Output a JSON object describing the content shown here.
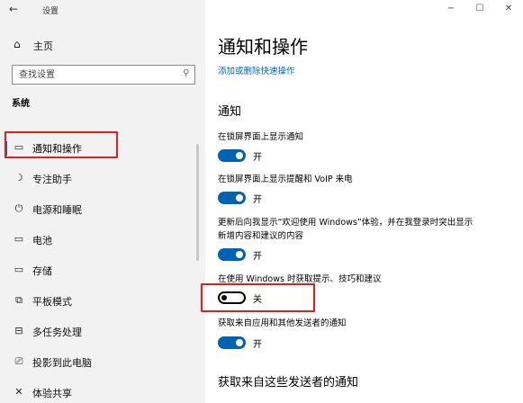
{
  "window": {
    "title": "设置",
    "back_glyph": "←",
    "controls": {
      "minimize": "−",
      "maximize": "☐",
      "close": "✕"
    }
  },
  "sidebar": {
    "home": {
      "label": "主页",
      "icon": "home-icon",
      "glyph": "⌂"
    },
    "search": {
      "placeholder": "查找设置",
      "icon": "search-icon",
      "glyph": "⚲"
    },
    "section": "系统",
    "sound": {
      "label": "声音",
      "icon": "speaker-icon",
      "glyph": "ᑁ))"
    },
    "items": [
      {
        "label": "通知和操作",
        "icon": "notification-icon",
        "glyph": "▭",
        "selected": true
      },
      {
        "label": "专注助手",
        "icon": "moon-icon",
        "glyph": "☽",
        "selected": false
      },
      {
        "label": "电源和睡眠",
        "icon": "power-icon",
        "glyph": "⏻",
        "selected": false
      },
      {
        "label": "电池",
        "icon": "battery-icon",
        "glyph": "▭",
        "selected": false
      },
      {
        "label": "存储",
        "icon": "storage-icon",
        "glyph": "▭",
        "selected": false
      },
      {
        "label": "平板模式",
        "icon": "tablet-mode-icon",
        "glyph": "⧉",
        "selected": false
      },
      {
        "label": "多任务处理",
        "icon": "multitasking-icon",
        "glyph": "⊟",
        "selected": false
      },
      {
        "label": "投影到此电脑",
        "icon": "projecting-icon",
        "glyph": "⎚",
        "selected": false
      },
      {
        "label": "体验共享",
        "icon": "shared-experiences-icon",
        "glyph": "✕",
        "selected": false
      }
    ]
  },
  "main": {
    "title": "通知和操作",
    "quick_actions_link": "添加或删除快速操作",
    "notifications_heading": "通知",
    "settings": [
      {
        "label": "在锁屏界面上显示通知",
        "state": "开",
        "on": true
      },
      {
        "label": "在锁屏界面上显示提醒和 VoIP 来电",
        "state": "开",
        "on": true
      },
      {
        "label": "更新后向我显示“欢迎使用 Windows”体验，并在我登录时突出显示新增内容和建议的内容",
        "label_line1": "更新后向我显示“欢迎使用 Windows”体验，并在我登录时突出显示",
        "label_line2": "新增内容和建议的内容",
        "state": "开",
        "on": true
      },
      {
        "label": "在使用 Windows 时获取提示、技巧和建议",
        "state": "关",
        "on": false
      },
      {
        "label": "获取来自应用和其他发送者的通知",
        "state": "开",
        "on": true
      }
    ],
    "senders_heading": "获取来自这些发送者的通知"
  },
  "colors": {
    "accent": "#0063b1",
    "link": "#0067b8",
    "highlight_box": "#e02020",
    "sidebar_bg": "#f2f2f2"
  }
}
